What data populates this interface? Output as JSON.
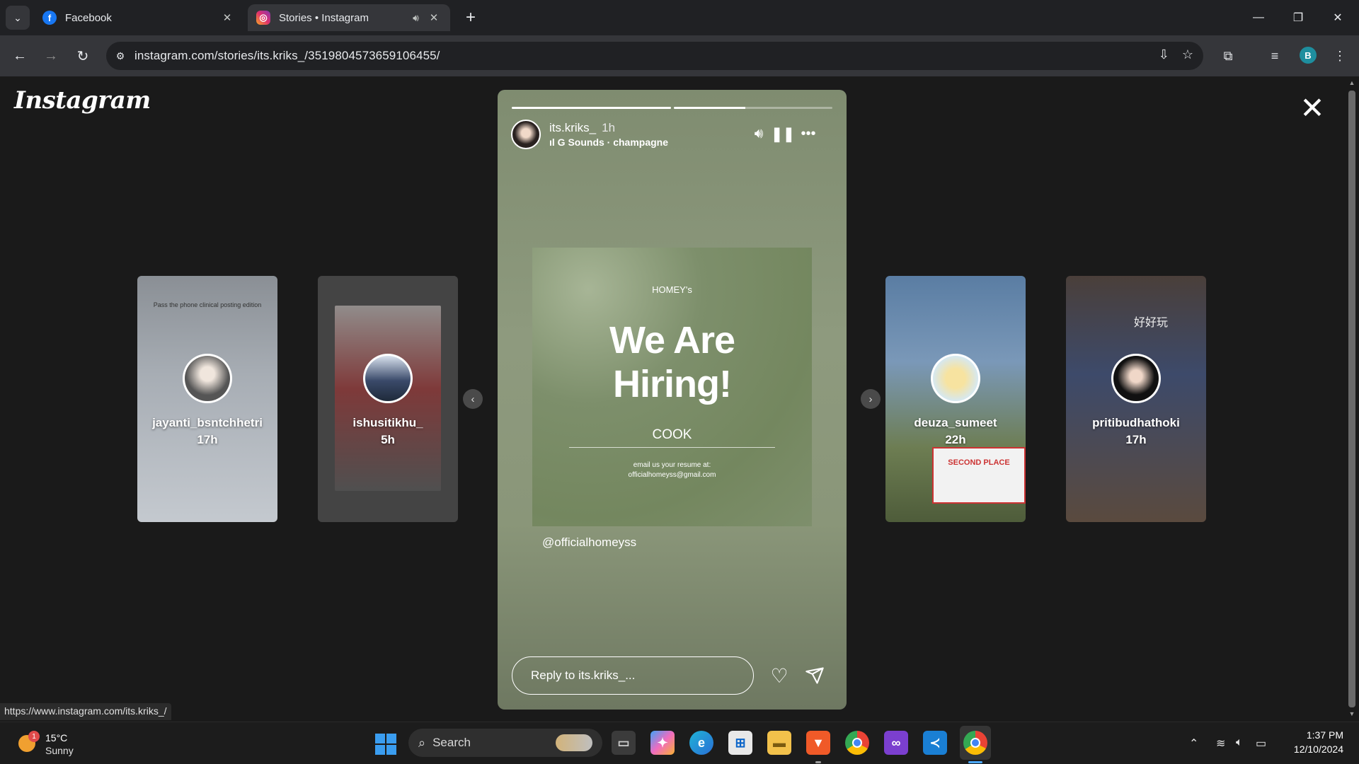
{
  "browser": {
    "tabs": [
      {
        "title": "Facebook",
        "icon": "facebook-icon"
      },
      {
        "title": "Stories • Instagram",
        "icon": "instagram-icon",
        "audio": true
      }
    ],
    "url": "instagram.com/stories/its.kriks_/3519804573659106455/",
    "profile_initial": "B",
    "status_url": "https://www.instagram.com/its.kriks_/"
  },
  "page": {
    "logo": "Instagram",
    "side_stories": [
      {
        "username": "jayanti_bsntchhetri",
        "time": "17h",
        "sticker": "Pass the phone clinical posting edition"
      },
      {
        "username": "ishusitikhu_",
        "time": "5h"
      },
      {
        "username": "deuza_sumeet",
        "time": "22h",
        "overlay": "SECOND PLACE"
      },
      {
        "username": "pritibudhathoki",
        "time": "17h",
        "overlay": "好好玩"
      }
    ],
    "story": {
      "username": "its.kriks_",
      "time": "1h",
      "music": "G Sounds · champagne",
      "progress": [
        1.0,
        0.45,
        0.0
      ],
      "card": {
        "brand": "HOMEY's",
        "title_line1": "We Are",
        "title_line2": "Hiring!",
        "role": "COOK",
        "email_line1": "email us your resume at:",
        "email_line2": "officialhomeyss@gmail.com"
      },
      "mention": "@officialhomeyss",
      "reply_placeholder": "Reply to its.kriks_..."
    }
  },
  "taskbar": {
    "weather": {
      "temp": "15°C",
      "condition": "Sunny",
      "badge": "1"
    },
    "search_label": "Search",
    "time": "1:37 PM",
    "date": "12/10/2024"
  }
}
